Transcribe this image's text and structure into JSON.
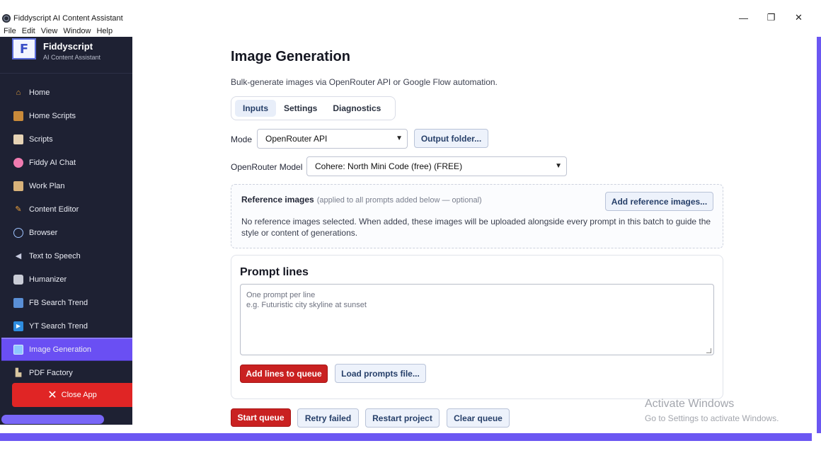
{
  "window": {
    "title": "Fiddyscript AI Content Assistant",
    "menu": [
      "File",
      "Edit",
      "View",
      "Window",
      "Help"
    ],
    "minimize": "—",
    "restore": "❐",
    "close": "✕"
  },
  "sidebar": {
    "brand_name": "Fiddyscript",
    "brand_sub": "AI Content Assistant",
    "logo_letter": "F",
    "items": [
      {
        "label": "Home",
        "icon": "house-icon"
      },
      {
        "label": "Home Scripts",
        "icon": "notebook-icon"
      },
      {
        "label": "Scripts",
        "icon": "scroll-icon"
      },
      {
        "label": "Fiddy AI Chat",
        "icon": "brain-icon"
      },
      {
        "label": "Work Plan",
        "icon": "clipboard-icon"
      },
      {
        "label": "Content Editor",
        "icon": "pencil-icon"
      },
      {
        "label": "Browser",
        "icon": "globe-icon"
      },
      {
        "label": "Text to Speech",
        "icon": "speaker-icon"
      },
      {
        "label": "Humanizer",
        "icon": "robot-icon"
      },
      {
        "label": "FB Search Trend",
        "icon": "chart-icon"
      },
      {
        "label": "YT Search Trend",
        "icon": "play-icon"
      },
      {
        "label": "Image Generation",
        "icon": "image-icon",
        "active": true
      },
      {
        "label": "PDF Factory",
        "icon": "factory-icon"
      }
    ],
    "close_app": "Close App"
  },
  "main": {
    "title": "Image Generation",
    "subtitle": "Bulk-generate images via OpenRouter API or Google Flow automation.",
    "tabs": [
      {
        "label": "Inputs",
        "active": true
      },
      {
        "label": "Settings"
      },
      {
        "label": "Diagnostics"
      }
    ],
    "mode_label": "Mode",
    "mode_value": "OpenRouter API",
    "output_folder": "Output folder...",
    "model_label": "OpenRouter Model",
    "model_value": "Cohere: North Mini Code (free) (FREE)",
    "reference": {
      "title": "Reference images",
      "hint": "(applied to all prompts added below — optional)",
      "add_button": "Add reference images...",
      "description": "No reference images selected. When added, these images will be uploaded alongside every prompt in this batch to guide the style or content of generations."
    },
    "prompt": {
      "title": "Prompt lines",
      "placeholder": "One prompt per line\ne.g. Futuristic city skyline at sunset",
      "add_button": "Add lines to queue",
      "load_button": "Load prompts file..."
    },
    "queue": {
      "start": "Start queue",
      "retry": "Retry failed",
      "restart": "Restart project",
      "clear": "Clear queue"
    }
  },
  "watermark": {
    "line1": "Activate Windows",
    "line2": "Go to Settings to activate Windows."
  },
  "colors": {
    "sidebar_bg": "#1e2133",
    "accent": "#6a4ff3",
    "danger": "#c92121"
  }
}
